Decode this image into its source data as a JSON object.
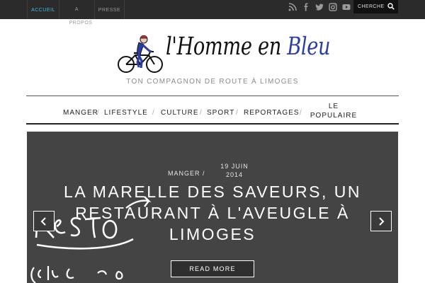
{
  "topnav": {
    "home": "ACCUEIL",
    "about": "A PROPOS",
    "press": "PRESSE"
  },
  "social": [
    "rss-icon",
    "facebook-icon",
    "twitter-icon",
    "instagram-icon",
    "youtube-icon"
  ],
  "search": {
    "placeholder": "CHERCHER"
  },
  "logo": {
    "text_black": "l'Homme en ",
    "text_blue": "Bleu",
    "color_blue": "#2d3ea0"
  },
  "tagline": "TON COMPAGNON DE ROUTE À LIMOGES",
  "mainnav": {
    "items": [
      "MANGER",
      "LIFESTYLE",
      "CULTURE",
      "SPORT",
      "REPORTAGES",
      "LE POPULAIRE"
    ]
  },
  "hero": {
    "category": "MANGER",
    "date": "19 JUIN 2014",
    "title": "LA MARELLE DES SAVEURS, UN RESTAURANT À L'AVEUGLE À LIMOGES",
    "read_more": "READ MORE",
    "image_handwriting": "RESTO (enfin, presque)"
  },
  "colors": {
    "topbar": "#2b2b2b",
    "accent_link": "#4ab3e6",
    "hero_bg": "#444444"
  }
}
